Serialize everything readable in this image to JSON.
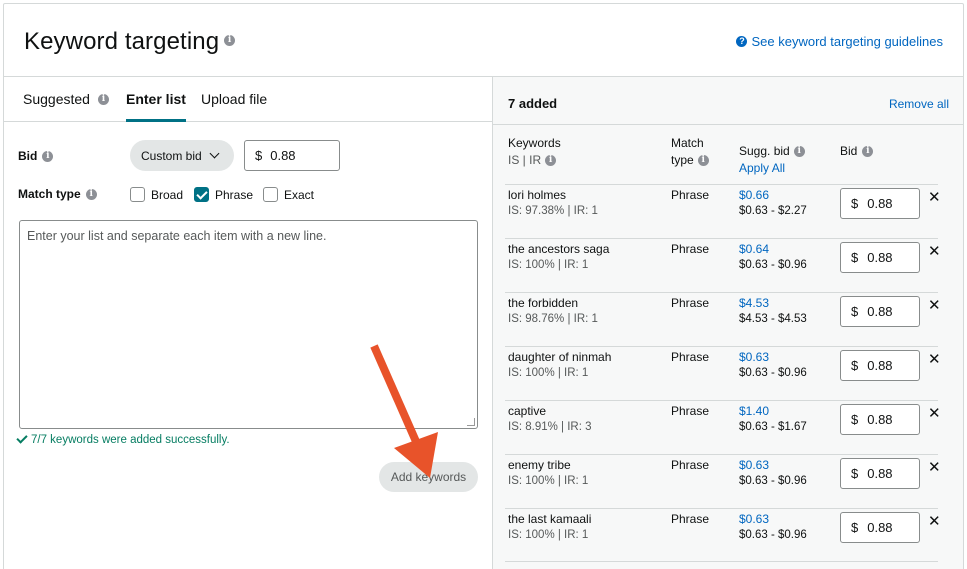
{
  "header": {
    "title": "Keyword targeting",
    "guide_link": "See keyword targeting guidelines"
  },
  "tabs": [
    {
      "label": "Suggested",
      "active": false
    },
    {
      "label": "Enter list",
      "active": true
    },
    {
      "label": "Upload file",
      "active": false
    }
  ],
  "form": {
    "bid_label": "Bid",
    "bid_type": "Custom bid",
    "currency": "$",
    "bid_value": "0.88",
    "match_type_label": "Match type",
    "match_types": [
      {
        "label": "Broad",
        "checked": false
      },
      {
        "label": "Phrase",
        "checked": true
      },
      {
        "label": "Exact",
        "checked": false
      }
    ],
    "textarea_placeholder": "Enter your list and separate each item with a new line.",
    "success_message": "7/7 keywords were added successfully.",
    "add_button": "Add keywords"
  },
  "added": {
    "count_label": "7 added",
    "remove_all": "Remove all",
    "headers": {
      "keywords": "Keywords",
      "is_ir": "IS | IR",
      "match_type": "Match",
      "match_type_2": "type",
      "sugg_bid": "Sugg. bid",
      "apply_all": "Apply All",
      "bid": "Bid"
    },
    "rows": [
      {
        "keyword": "lori holmes",
        "meta": "IS: 97.38% | IR: 1",
        "match": "Phrase",
        "sugg": "$0.66",
        "range": "$0.63 - $2.27",
        "bid": "0.88"
      },
      {
        "keyword": "the ancestors saga",
        "meta": "IS: 100% | IR: 1",
        "match": "Phrase",
        "sugg": "$0.64",
        "range": "$0.63 - $0.96",
        "bid": "0.88"
      },
      {
        "keyword": "the forbidden",
        "meta": "IS: 98.76% | IR: 1",
        "match": "Phrase",
        "sugg": "$4.53",
        "range": "$4.53 - $4.53",
        "bid": "0.88"
      },
      {
        "keyword": "daughter of ninmah",
        "meta": "IS: 100% | IR: 1",
        "match": "Phrase",
        "sugg": "$0.63",
        "range": "$0.63 - $0.96",
        "bid": "0.88"
      },
      {
        "keyword": "captive",
        "meta": "IS: 8.91% | IR: 3",
        "match": "Phrase",
        "sugg": "$1.40",
        "range": "$0.63 - $1.67",
        "bid": "0.88"
      },
      {
        "keyword": "enemy tribe",
        "meta": "IS: 100% | IR: 1",
        "match": "Phrase",
        "sugg": "$0.63",
        "range": "$0.63 - $0.96",
        "bid": "0.88"
      },
      {
        "keyword": "the last kamaali",
        "meta": "IS: 100% | IR: 1",
        "match": "Phrase",
        "sugg": "$0.63",
        "range": "$0.63 - $0.96",
        "bid": "0.88"
      }
    ]
  },
  "colors": {
    "accent": "#007185",
    "link": "#0066c0",
    "success": "#067d62",
    "annotation_arrow": "#e8532a"
  },
  "icons": {
    "info": "info-icon",
    "help": "question-circle-icon",
    "remove": "close-icon",
    "dropdown": "chevron-down-icon",
    "success": "check-icon",
    "annotation": "arrow-annotation-icon"
  }
}
